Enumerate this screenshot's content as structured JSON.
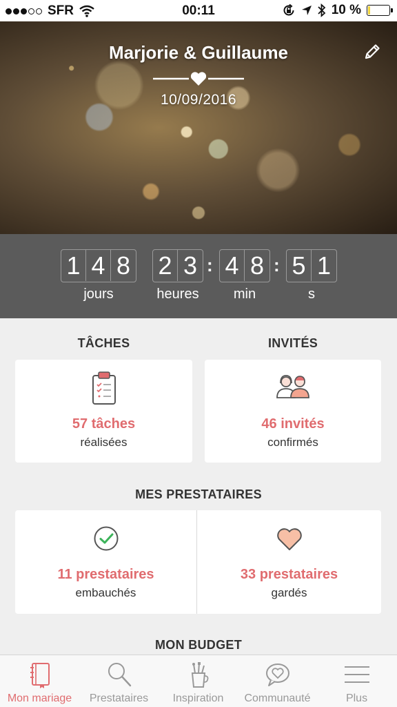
{
  "status_bar": {
    "carrier": "SFR",
    "time": "00:11",
    "battery": "10 %",
    "battery_level": 0.1
  },
  "header": {
    "couple": "Marjorie & Guillaume",
    "date": "10/09/2016"
  },
  "countdown": {
    "days": [
      "1",
      "4",
      "8"
    ],
    "hours": [
      "2",
      "3"
    ],
    "minutes": [
      "4",
      "8"
    ],
    "seconds": [
      "5",
      "1"
    ],
    "separator": ":",
    "labels": {
      "days": "jours",
      "hours": "heures",
      "minutes": "min",
      "seconds": "s"
    }
  },
  "tasks": {
    "title": "TÂCHES",
    "value": "57 tâches",
    "sub": "réalisées"
  },
  "guests": {
    "title": "INVITÉS",
    "value": "46 invités",
    "sub": "confirmés"
  },
  "vendors": {
    "title": "MES PRESTATAIRES",
    "hired": {
      "value": "11 prestataires",
      "sub": "embauchés"
    },
    "saved": {
      "value": "33 prestataires",
      "sub": "gardés"
    }
  },
  "budget": {
    "title": "MON BUDGET"
  },
  "nav": {
    "items": [
      {
        "label": "Mon mariage",
        "icon": "notebook-icon",
        "active": true
      },
      {
        "label": "Prestataires",
        "icon": "search-icon",
        "active": false
      },
      {
        "label": "Inspiration",
        "icon": "brush-cup-icon",
        "active": false
      },
      {
        "label": "Communauté",
        "icon": "chat-heart-icon",
        "active": false
      },
      {
        "label": "Plus",
        "icon": "menu-icon",
        "active": false
      }
    ]
  },
  "colors": {
    "accent": "#e06c6f",
    "countdown_bg": "#5b5b5b",
    "page_bg": "#efefef"
  }
}
